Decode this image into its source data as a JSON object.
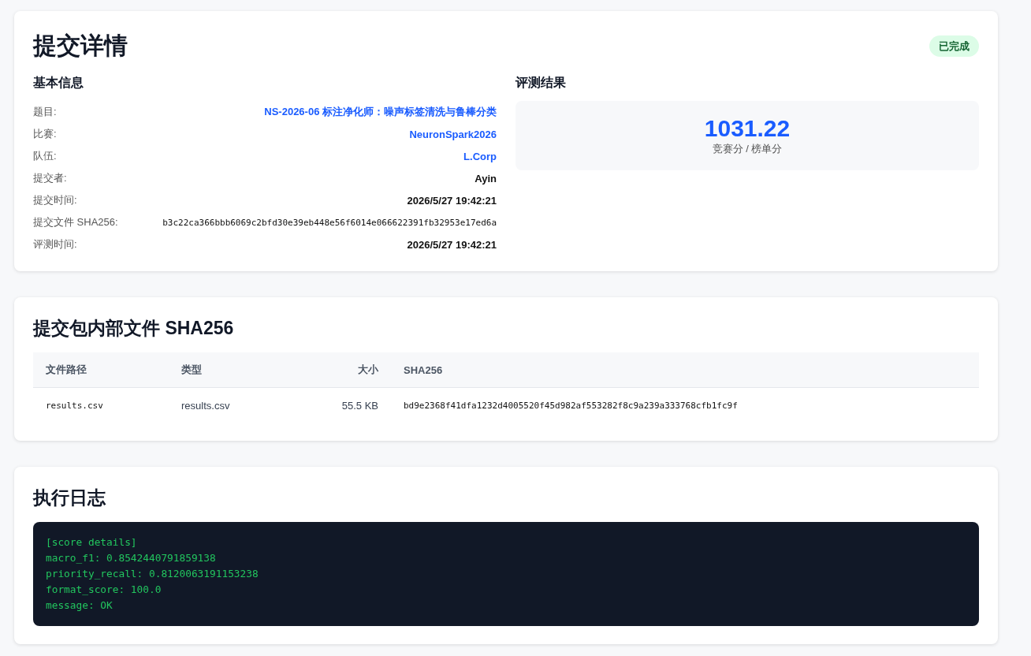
{
  "submission": {
    "title": "提交详情",
    "status": {
      "label": "已完成",
      "kind": "done"
    }
  },
  "basic_info": {
    "heading": "基本信息",
    "rows": [
      {
        "label": "题目:",
        "value": "NS-2026-06 标注净化师：噪声标签清洗与鲁棒分类",
        "kind": "link"
      },
      {
        "label": "比赛:",
        "value": "NeuronSpark2026",
        "kind": "link"
      },
      {
        "label": "队伍:",
        "value": "L.Corp",
        "kind": "link"
      },
      {
        "label": "提交者:",
        "value": "Ayin",
        "kind": "strong"
      },
      {
        "label": "提交时间:",
        "value": "2026/5/27 19:42:21",
        "kind": "strong"
      },
      {
        "label": "提交文件 SHA256:",
        "value": "b3c22ca366bbb6069c2bfd30e39eb448e56f6014e066622391fb32953e17ed6a",
        "kind": "mono"
      },
      {
        "label": "评测时间:",
        "value": "2026/5/27 19:42:21",
        "kind": "strong"
      }
    ]
  },
  "result": {
    "heading": "评测结果",
    "score": "1031.22",
    "score_label": "竞赛分 / 榜单分"
  },
  "files": {
    "title": "提交包内部文件 SHA256",
    "columns": [
      "文件路径",
      "类型",
      "大小",
      "SHA256"
    ],
    "rows": [
      [
        "results.csv",
        "results.csv",
        "55.5 KB",
        "bd9e2368f41dfa1232d4005520f45d982af553282f8c9a239a333768cfb1fc9f"
      ]
    ]
  },
  "log": {
    "title": "执行日志",
    "lines": [
      "[score details]",
      "macro_f1: 0.8542440791859138",
      "priority_recall: 0.8120063191153238",
      "format_score: 100.0",
      "message: OK"
    ]
  }
}
